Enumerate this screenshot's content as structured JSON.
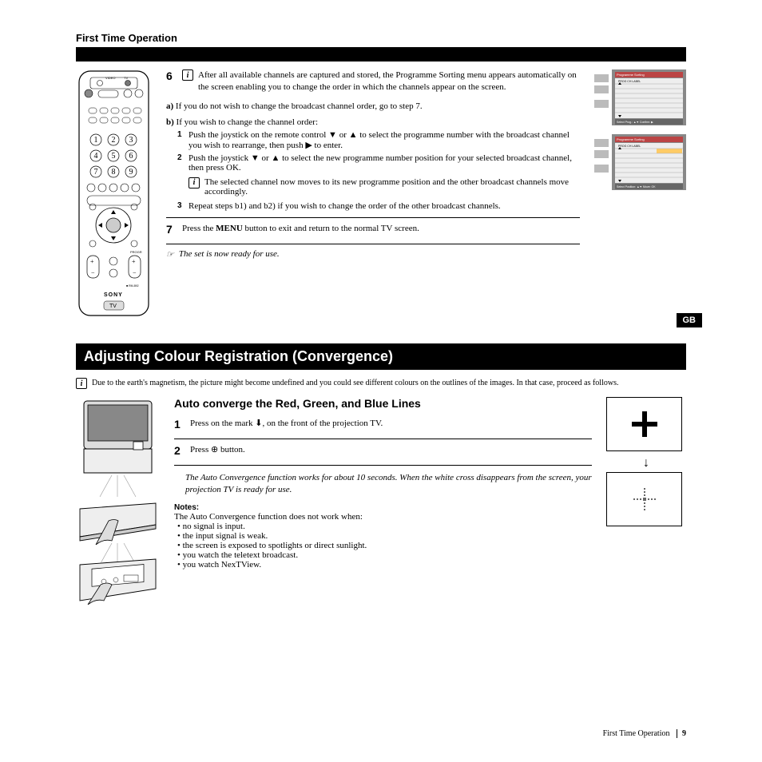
{
  "header": {
    "title": "First Time Operation"
  },
  "step6": {
    "num": "6",
    "text": "After all available channels are captured and stored, the Programme Sorting menu appears automatically on the screen enabling you to change the order in which the channels appear on the screen."
  },
  "sub_a": {
    "label": "a)",
    "text": "If you do not wish to change the broadcast channel order, go to step 7."
  },
  "sub_b": {
    "label": "b)",
    "text": "If you wish to change the channel order:",
    "s1": {
      "num": "1",
      "text": "Push the joystick on the remote control ▼ or ▲ to select the programme number with the broadcast channel you wish to rearrange, then push ▶ to enter."
    },
    "s2": {
      "num": "2",
      "text": "Push the joystick ▼ or ▲ to select the new programme number position for your selected broadcast channel, then press OK."
    },
    "note": "The selected channel now moves to its new programme position and the other broadcast channels move accordingly.",
    "s3": {
      "num": "3",
      "text": "Repeat steps b1) and b2) if you wish to change the order of the other broadcast channels."
    }
  },
  "step7": {
    "num": "7",
    "text_pre": "Press the ",
    "text_bold": "MENU",
    "text_post": " button to exit and return to the normal TV screen."
  },
  "ready_note": "The set is now ready for use.",
  "gb": "GB",
  "osd": {
    "title": "Programme Sorting",
    "col1": "PROG",
    "col2": "CH",
    "col3": "LABEL",
    "footer1": "Select Prog.: ▲▼   Confirm: ▶",
    "footer2": "Select Position: ▲▼   Move: OK"
  },
  "convergence": {
    "title": "Adjusting Colour Registration (Convergence)",
    "intro": "Due to the earth's magnetism, the picture might become undefined and you could see different colours on the outlines of the images. In that case, proceed as follows.",
    "subtitle": "Auto converge the Red, Green, and Blue Lines",
    "s1": {
      "num": "1",
      "text": "Press on the mark ⬇, on the front of the projection TV."
    },
    "s2": {
      "num": "2",
      "text": "Press ⊕ button."
    },
    "italic": "The Auto Convergence function works for about 10 seconds. When the white cross disappears from the screen, your projection TV is ready for use.",
    "notes_title": "Notes:",
    "notes_intro": "The Auto Convergence function does not work when:",
    "bullets": {
      "b1": "no signal is input.",
      "b2": "the input signal is weak.",
      "b3": "the screen is exposed to spotlights or direct sunlight.",
      "b4": "you watch the teletext broadcast.",
      "b5": "you watch NexTView."
    }
  },
  "footer": {
    "label": "First Time Operation",
    "page": "9"
  }
}
